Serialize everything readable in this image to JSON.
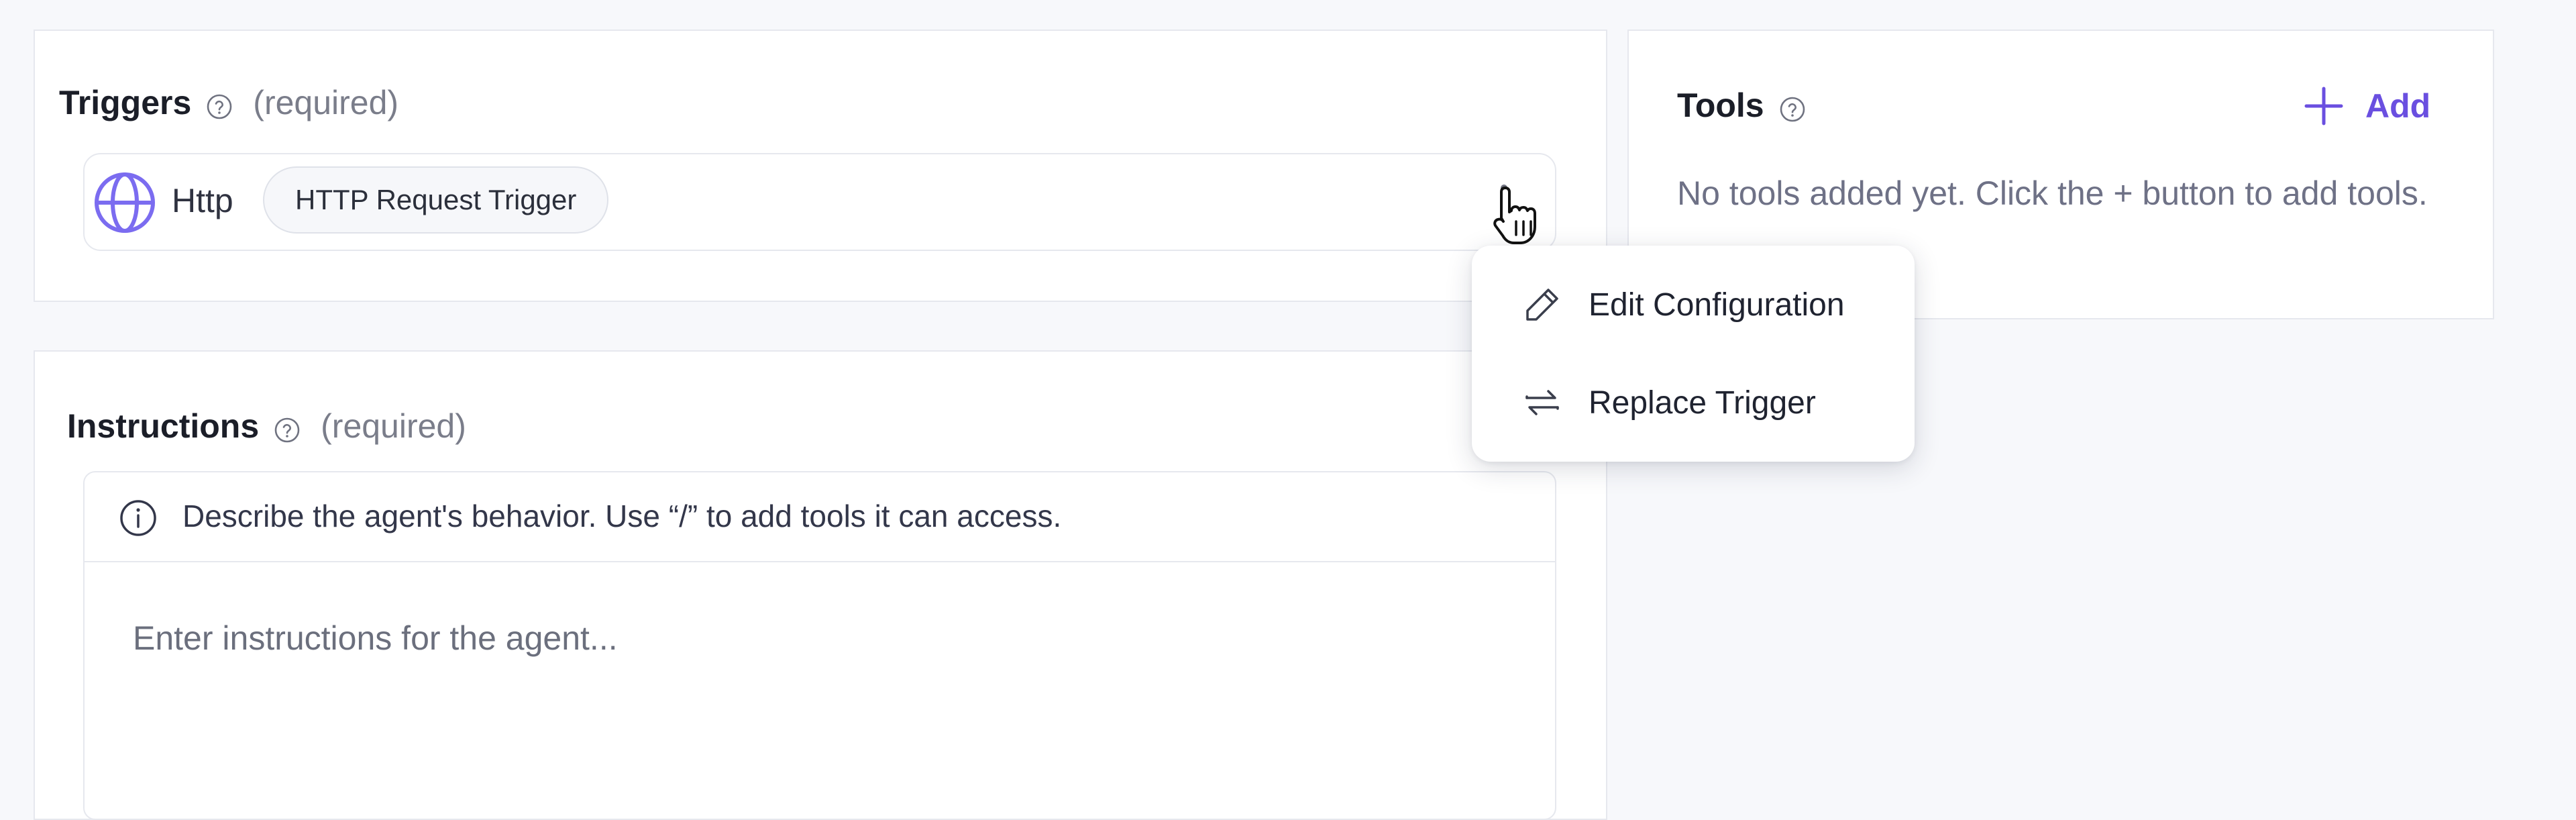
{
  "triggers": {
    "title": "Triggers",
    "required_label": "(required)",
    "item": {
      "name": "Http",
      "chip": "HTTP Request Trigger"
    }
  },
  "context_menu": {
    "items": [
      {
        "label": "Edit Configuration",
        "icon": "pencil-icon"
      },
      {
        "label": "Replace Trigger",
        "icon": "swap-arrows-icon"
      }
    ]
  },
  "instructions": {
    "title": "Instructions",
    "required_label": "(required)",
    "hint": "Describe the agent's behavior. Use “/” to add tools it can access.",
    "placeholder": "Enter instructions for the agent..."
  },
  "tools": {
    "title": "Tools",
    "add_label": "Add",
    "empty_text": "No tools added yet. Click the + button to add tools."
  },
  "colors": {
    "accent": "#6a4fe0",
    "globe": "#7b6cf0",
    "muted": "#7a7d8a"
  }
}
